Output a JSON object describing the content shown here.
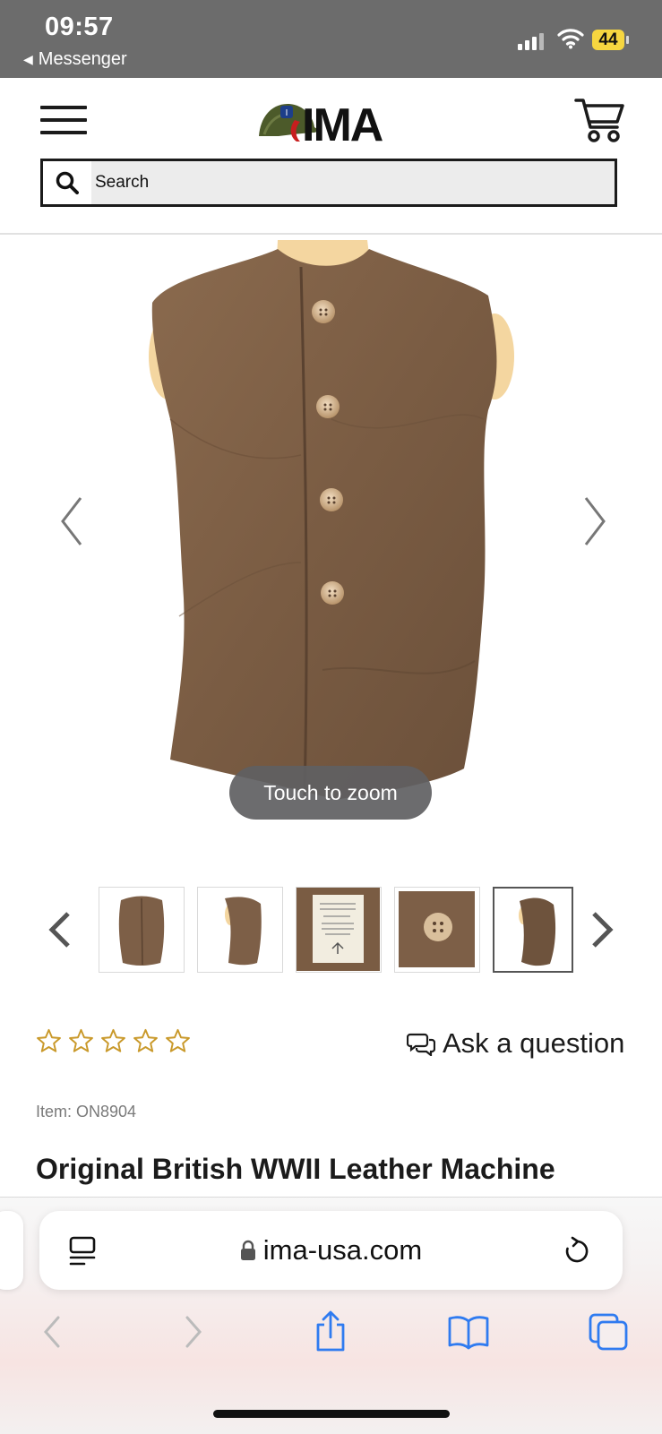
{
  "status_bar": {
    "time": "09:57",
    "back_app": "Messenger",
    "battery": "44",
    "icons": [
      "signal-icon",
      "wifi-icon",
      "battery-icon"
    ]
  },
  "header": {
    "logo_text": "IMA",
    "search_placeholder": "Search",
    "icons": [
      "menu-icon",
      "cart-icon",
      "search-icon"
    ]
  },
  "product_gallery": {
    "zoom_hint": "Touch to zoom",
    "thumbnails": [
      "vest-front",
      "vest-side",
      "vest-label",
      "vest-button",
      "vest-back"
    ],
    "active_thumbnail": 4
  },
  "product": {
    "rating_stars": 0,
    "rating_max": 5,
    "ask_question": "Ask a question",
    "item_code": "Item: ON8904",
    "title": "Original British WWII Leather Machine"
  },
  "browser": {
    "url": "ima-usa.com",
    "icons": [
      "reader-icon",
      "lock-icon",
      "reload-icon",
      "back-icon",
      "forward-icon",
      "share-icon",
      "bookmarks-icon",
      "tabs-icon"
    ]
  },
  "colors": {
    "status_bar_bg": "#6c6c6c",
    "battery_yellow": "#f6d640",
    "star_gold": "#c9992a",
    "text_dark": "#1b1b1b",
    "link_blue": "#2f7bf0",
    "logo_red": "#c81e1e",
    "helmet_green": "#4c5a2a"
  }
}
